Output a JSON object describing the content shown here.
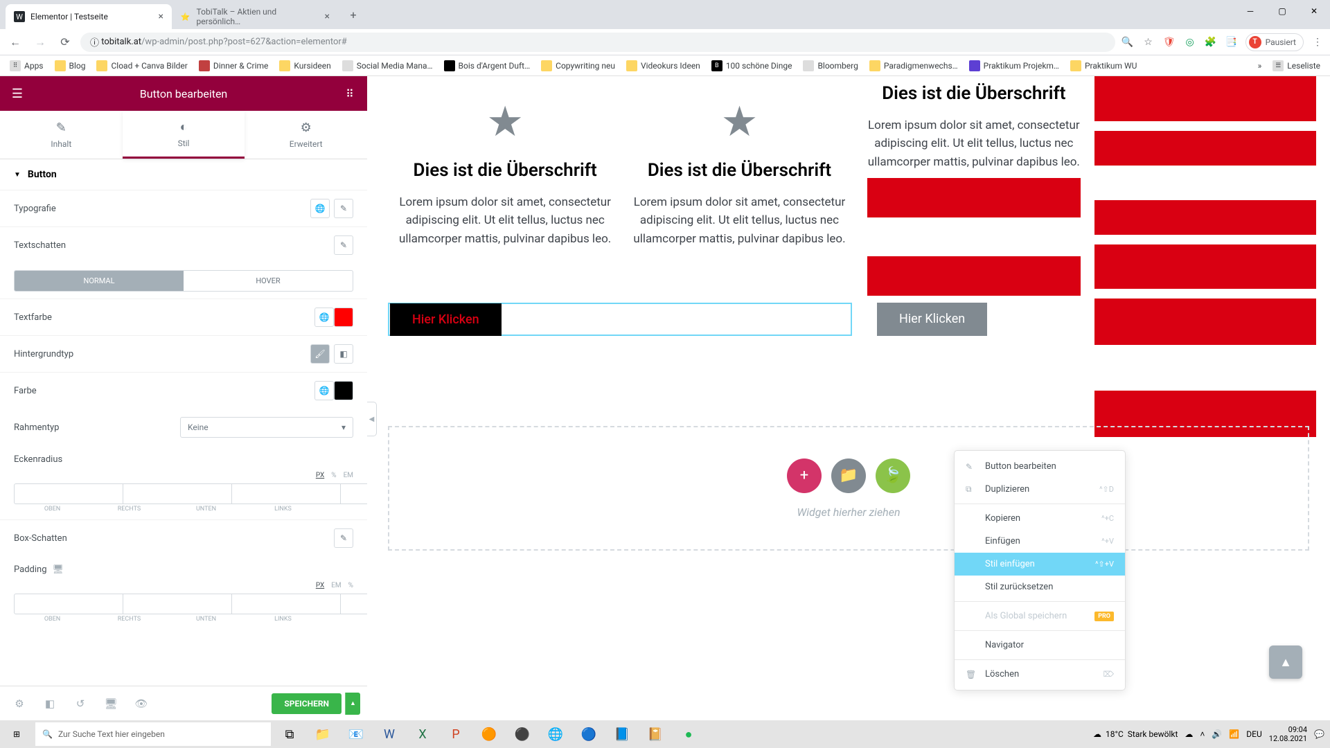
{
  "browser": {
    "tabs": [
      {
        "title": "Elementor | Testseite",
        "favicon": "W"
      },
      {
        "title": "TobiTalk – Aktien und persönlich…",
        "favicon": "⭐"
      }
    ],
    "url_domain": "tobitalk.at",
    "url_rest": "/wp-admin/post.php?post=627&action=elementor#",
    "avatar_label": "Pausiert",
    "avatar_letter": "T"
  },
  "bookmarks": [
    "Apps",
    "Blog",
    "Cload + Canva Bilder",
    "Dinner & Crime",
    "Kursideen",
    "Social Media Mana…",
    "Bois d'Argent Duft…",
    "Copywriting neu",
    "Videokurs Ideen",
    "100 schöne Dinge",
    "Bloomberg",
    "Paradigmenwechs…",
    "Praktikum Projekm…",
    "Praktikum WU"
  ],
  "bookmarks_overflow": "Leseliste",
  "elementor": {
    "header": "Button bearbeiten",
    "tabs": {
      "content": "Inhalt",
      "style": "Stil",
      "advanced": "Erweitert"
    },
    "section": "Button",
    "typography": "Typografie",
    "textshadow": "Textschatten",
    "state_normal": "NORMAL",
    "state_hover": "HOVER",
    "textcolor": "Textfarbe",
    "textcolor_value": "#ff0000",
    "bgtype": "Hintergrundtyp",
    "bgcolor": "Farbe",
    "bgcolor_value": "#000000",
    "bordertype": "Rahmentyp",
    "bordertype_value": "Keine",
    "borderradius": "Eckenradius",
    "units": [
      "PX",
      "%",
      "EM"
    ],
    "side_labels": [
      "OBEN",
      "RECHTS",
      "UNTEN",
      "LINKS"
    ],
    "boxshadow": "Box-Schatten",
    "padding": "Padding",
    "save": "SPEICHERN"
  },
  "canvas": {
    "heading": "Dies ist die Überschrift",
    "lorem": "Lorem ipsum dolor sit amet, consectetur adipiscing elit. Ut elit tellus, luctus nec ullamcorper mattis, pulvinar dapibus leo.",
    "btn_text": "Hier Klicken",
    "drop_hint": "Widget hierher ziehen"
  },
  "context": {
    "edit": "Button bearbeiten",
    "duplicate": "Duplizieren",
    "dup_sc": "^⇧D",
    "copy": "Kopieren",
    "copy_sc": "^+C",
    "paste": "Einfügen",
    "paste_sc": "^+V",
    "paste_style": "Stil einfügen",
    "paste_style_sc": "^⇧+V",
    "reset_style": "Stil zurücksetzen",
    "save_global": "Als Global speichern",
    "pro": "PRO",
    "navigator": "Navigator",
    "delete": "Löschen"
  },
  "taskbar": {
    "search_ph": "Zur Suche Text hier eingeben",
    "weather_temp": "18°C",
    "weather_text": "Stark bewölkt",
    "time": "09:04",
    "date": "12.08.2021",
    "lang": "DEU"
  }
}
